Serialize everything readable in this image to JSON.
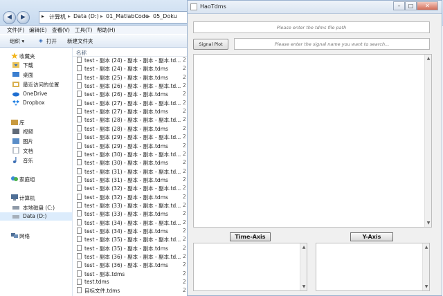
{
  "explorer": {
    "address": [
      "计算机",
      "Data (D:)",
      "01_MatlabCode",
      "05_Doku"
    ],
    "menu": [
      "文件(F)",
      "编辑(E)",
      "查看(V)",
      "工具(T)",
      "帮助(H)"
    ],
    "toolbar": {
      "organize": "组织 ▾",
      "open": "打开",
      "new_folder": "新建文件夹"
    },
    "nav": {
      "favorites": "收藏夹",
      "downloads": "下载",
      "desktop": "桌面",
      "recent": "最近访问的位置",
      "onedrive": "OneDrive",
      "dropbox": "Dropbox",
      "libraries": "库",
      "videos": "视频",
      "pictures": "图片",
      "documents": "文档",
      "music": "音乐",
      "homegroup": "家庭组",
      "computer": "计算机",
      "local_disk": "本地磁盘 (C:)",
      "data_disk": "Data (D:)",
      "network": "网络"
    },
    "column_header": "名称",
    "date_prefix": "2",
    "files": [
      "test - 副本 (24) - 副本 - 副本 - 副本.td...",
      "test - 副本 (24) - 副本 - 副本.tdms",
      "test - 副本 (25) - 副本 - 副本.tdms",
      "test - 副本 (26) - 副本 - 副本 - 副本.td...",
      "test - 副本 (26) - 副本 - 副本.tdms",
      "test - 副本 (27) - 副本 - 副本 - 副本.td...",
      "test - 副本 (27) - 副本 - 副本.tdms",
      "test - 副本 (28) - 副本 - 副本 - 副本.td...",
      "test - 副本 (28) - 副本 - 副本.tdms",
      "test - 副本 (29) - 副本 - 副本 - 副本.td...",
      "test - 副本 (29) - 副本 - 副本.tdms",
      "test - 副本 (30) - 副本 - 副本 - 副本.td...",
      "test - 副本 (30) - 副本 - 副本.tdms",
      "test - 副本 (31) - 副本 - 副本 - 副本.td...",
      "test - 副本 (31) - 副本 - 副本.tdms",
      "test - 副本 (32) - 副本 - 副本 - 副本.td...",
      "test - 副本 (32) - 副本 - 副本.tdms",
      "test - 副本 (33) - 副本 - 副本 - 副本.td...",
      "test - 副本 (33) - 副本 - 副本.tdms",
      "test - 副本 (34) - 副本 - 副本 - 副本.td...",
      "test - 副本 (34) - 副本 - 副本.tdms",
      "test - 副本 (35) - 副本 - 副本 - 副本.td...",
      "test - 副本 (35) - 副本 - 副本.tdms",
      "test - 副本 (36) - 副本 - 副本 - 副本.td...",
      "test - 副本 (36) - 副本 - 副本.tdms",
      "test - 副本.tdms",
      "test.tdms",
      "目标文件.tdms"
    ]
  },
  "app": {
    "title": "HaoTdms",
    "path_placeholder": "Please enter the tdms file path",
    "signal_plot_label": "Signal Plot",
    "search_placeholder": "Please enter the signal name you want to search...",
    "time_axis_label": "Time-Axis",
    "y_axis_label": "Y-Axis"
  }
}
